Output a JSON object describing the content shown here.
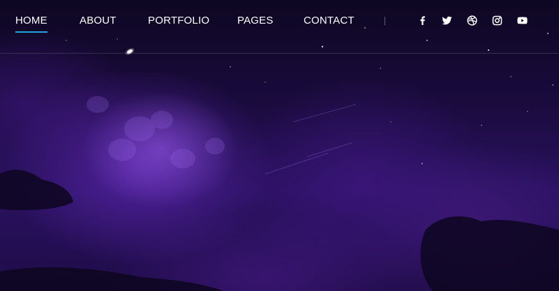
{
  "nav": {
    "items": [
      {
        "label": "HOME",
        "active": true
      },
      {
        "label": "ABOUT",
        "active": false
      },
      {
        "label": "PORTFOLIO",
        "active": false
      },
      {
        "label": "PAGES",
        "active": false
      },
      {
        "label": "CONTACT",
        "active": false
      }
    ],
    "social": [
      "facebook-icon",
      "twitter-icon",
      "dribbble-icon",
      "instagram-icon",
      "youtube-icon"
    ]
  },
  "colors": {
    "accent": "#23a6e0",
    "nav_text": "#ffffff",
    "background_dark": "#0e0722",
    "background_purple": "#2a1160"
  }
}
